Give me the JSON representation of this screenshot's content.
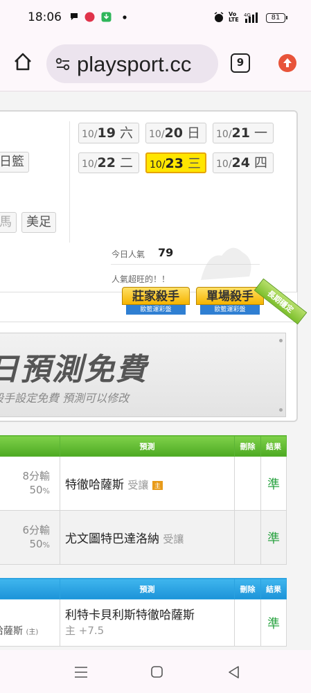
{
  "status_bar": {
    "time": "18:06",
    "battery": "81",
    "icons": [
      "chat-bubble-icon",
      "notification-app-icon",
      "download-app-icon",
      "dot-icon",
      "alarm-icon",
      "volte-icon",
      "signal-4g-icon",
      "battery-icon"
    ]
  },
  "browser": {
    "url": "playsport.cc",
    "tab_count": "9"
  },
  "date_chips": [
    {
      "month": "10/",
      "day": "19",
      "weekday": "六"
    },
    {
      "month": "10/",
      "day": "20",
      "weekday": "日"
    },
    {
      "month": "10/",
      "day": "21",
      "weekday": "一"
    },
    {
      "month": "10/",
      "day": "22",
      "weekday": "二"
    },
    {
      "month": "10/",
      "day": "23",
      "weekday": "三",
      "selected": true
    },
    {
      "month": "10/",
      "day": "24",
      "weekday": "四"
    }
  ],
  "left_chips": [
    "日籃",
    "馬",
    "美足"
  ],
  "popularity": {
    "label": "今日人氣",
    "value": "79",
    "note": "人氣超旺的！！"
  },
  "badges": [
    {
      "title": "莊家殺手",
      "sub": "歐籃運彩盤"
    },
    {
      "title": "單場殺手",
      "sub": "歐籃運彩盤"
    },
    {
      "ribbon": "長期穩定"
    }
  ],
  "banner": {
    "title": "日預測免費",
    "subtitle": "殺手設定免費 預測可以修改"
  },
  "table_green": {
    "headers": {
      "predict": "預測",
      "delete": "刪除",
      "result": "結果"
    },
    "rows": [
      {
        "loss": "8分輸",
        "pct": "50",
        "pct_unit": "%",
        "team": "特徹哈薩斯",
        "handicap": "受讓",
        "tag": "主"
      },
      {
        "loss": "6分輸",
        "pct": "50",
        "pct_unit": "%",
        "team": "尤文圖特巴達洛納",
        "handicap": "受讓",
        "tag": ""
      }
    ],
    "results": [
      "準",
      "準"
    ]
  },
  "table_blue": {
    "headers": {
      "predict": "預測",
      "delete": "刪除",
      "result": "結果"
    },
    "rows": [
      {
        "left": "哈薩斯",
        "left_tag": "(主)",
        "team": "利特卡貝利斯特徹哈薩斯",
        "line": "主 +7.5"
      }
    ],
    "results": [
      "準"
    ]
  },
  "nav": {
    "icons": [
      "menu-icon",
      "home-square-icon",
      "back-triangle-icon"
    ]
  },
  "colors": {
    "selected_date": "#ffe600",
    "green_header": "#4da922",
    "blue_header": "#1c93d8",
    "result_text": "#2da444"
  }
}
